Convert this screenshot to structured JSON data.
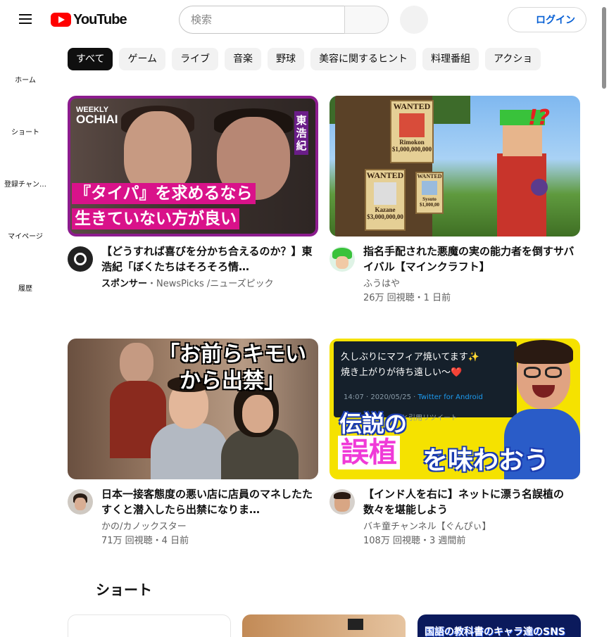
{
  "header": {
    "logo_text": "YouTube",
    "search_placeholder": "検索",
    "login_label": "ログイン"
  },
  "sidebar": {
    "items": [
      {
        "label": "ホーム",
        "icon": "home-icon"
      },
      {
        "label": "ショート",
        "icon": "shorts-icon"
      },
      {
        "label": "登録チャン…",
        "icon": "subscriptions-icon"
      },
      {
        "label": "マイページ",
        "icon": "library-icon"
      },
      {
        "label": "履歴",
        "icon": "history-icon"
      }
    ]
  },
  "chips": [
    "すべて",
    "ゲーム",
    "ライブ",
    "音楽",
    "野球",
    "美容に関するヒント",
    "料理番組",
    "アクショ"
  ],
  "videos": [
    {
      "title": "【どうすれば喜びを分かち合えるのか？】東浩紀「ぼくたちはそろそろ情…",
      "sponsor": "スポンサー",
      "channel": "・NewsPicks /ニューズピック",
      "stats": "",
      "thumb": {
        "weekly": "WEEKLY",
        "show": "OCHIAI",
        "name": "東浩紀",
        "caption1": "『タイパ』を求めるなら",
        "caption2": "生きていない方が良い"
      }
    },
    {
      "title": "指名手配された悪魔の実の能力者を倒すサバイバル【マインクラフト】",
      "channel": "ふうはや",
      "stats": "26万 回視聴・1 日前",
      "thumb": {
        "wanted1": "WANTED",
        "name1": "Rimokon",
        "bounty1": "$1,000,000,000",
        "wanted2": "WANTED",
        "name2": "Kazane",
        "bounty2": "$3,000,000,00",
        "wanted3": "WANTED",
        "name3": "Sysuto",
        "bounty3": "$1,000,00",
        "mark": "!?"
      }
    },
    {
      "title": "日本一接客態度の悪い店に店員のマネしたたすくと潜入したら出禁になりま…",
      "channel": "かの/カノックスター",
      "stats": "71万 回視聴・4 日前",
      "thumb": {
        "caption1": "「お前らキモい",
        "caption2": "から出禁」"
      }
    },
    {
      "title": "【インド人を右に】ネットに漂う名誤植の数々を堪能しよう",
      "channel": "バキ童チャンネル【ぐんぴぃ】",
      "stats": "108万 回視聴・3 週間前",
      "thumb": {
        "tweet1": "久しぶりにマフィア焼いてます✨",
        "tweet2": "焼き上がりが待ち遠しい〜❤️",
        "tweet_time": "14:07 · 2020/05/25 · ",
        "tweet_source": "Twitter for Android",
        "tweet_action": "と引用リツイート",
        "big1": "伝説の",
        "big2": "誤植",
        "big3": "を味わおう"
      }
    }
  ],
  "shorts": {
    "heading": "ショート",
    "third_caption": "国語の教科書のキャラ達のSNS"
  },
  "colors": {
    "brand_red": "#ff0000",
    "link_blue": "#065fd4",
    "chip_active": "#0f0f0f"
  }
}
